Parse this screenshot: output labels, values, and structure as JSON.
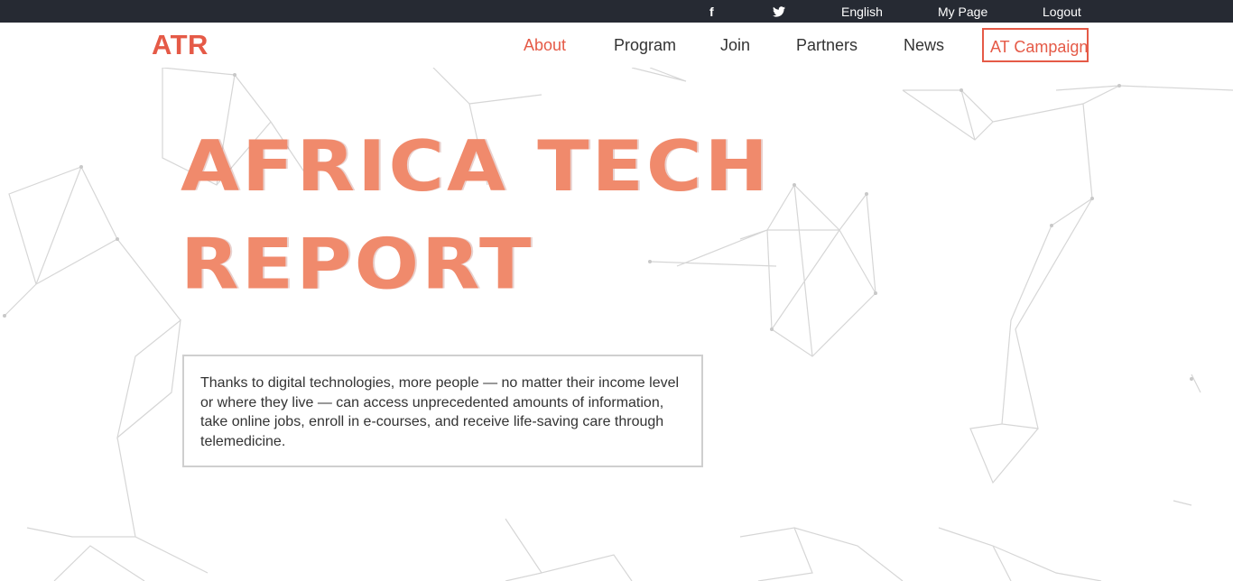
{
  "colors": {
    "accent": "#e55a47",
    "hero": "#f08a6c",
    "hero_dark": "#a8473a",
    "topbar_bg": "#262a33",
    "nav_text": "#333333",
    "network_line": "#d2d2d2"
  },
  "topbar": {
    "social": [
      {
        "name": "facebook-icon",
        "glyph": "f"
      },
      {
        "name": "twitter-icon",
        "glyph": "t"
      }
    ],
    "language": "English",
    "my_page": "My Page",
    "logout": "Logout"
  },
  "nav": {
    "logo": "ATR",
    "links": [
      "About",
      "Program",
      "Join",
      "Partners",
      "News"
    ],
    "active": "About",
    "campaign": "AT Campaign"
  },
  "hero": {
    "title_line1": "AFRICA TECH",
    "title_line2": "REPORT"
  },
  "description": "Thanks to digital technologies, more people — no matter their income level or where they live — can access unprecedented amounts of information, take online jobs, enroll in e-courses, and receive life-saving care through telemedicine."
}
